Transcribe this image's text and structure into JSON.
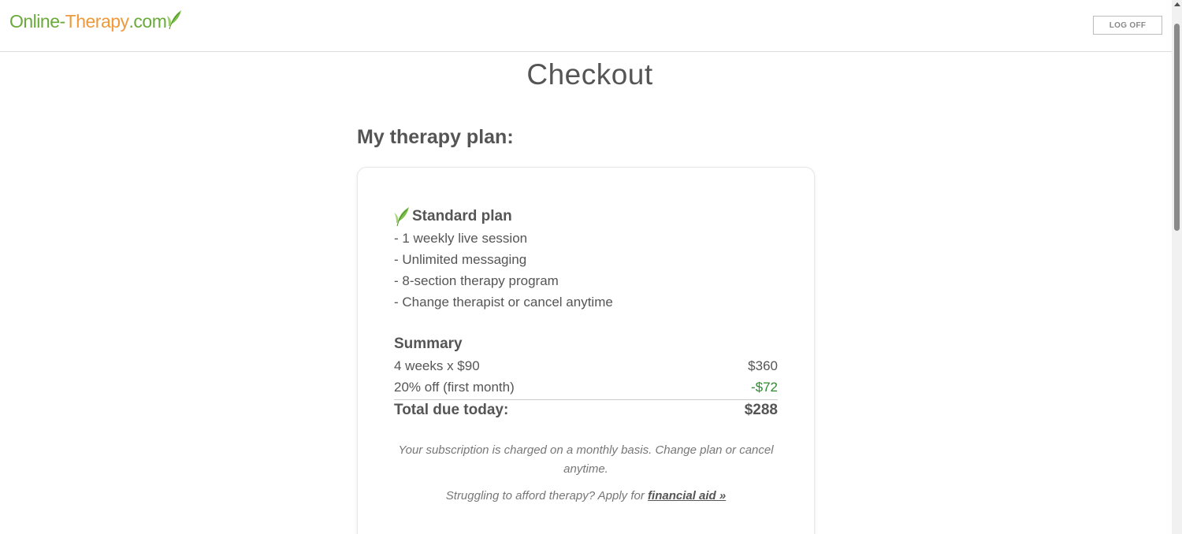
{
  "header": {
    "logo_part1": "Online-",
    "logo_part2": "Therapy",
    "logo_part3": ".com",
    "logoff_label": "LOG OFF"
  },
  "page": {
    "title": "Checkout",
    "plan_heading": "My therapy plan:"
  },
  "plan": {
    "name": "Standard plan",
    "features": [
      "- 1 weekly live session",
      "- Unlimited messaging",
      "- 8-section therapy program",
      "- Change therapist or cancel anytime"
    ]
  },
  "summary": {
    "title": "Summary",
    "lines": [
      {
        "label": "4 weeks x $90",
        "amount": "$360"
      },
      {
        "label": "20% off (first month)",
        "amount": "-$72"
      }
    ],
    "total_label": "Total due today:",
    "total_amount": "$288"
  },
  "notes": {
    "subscription": "Your subscription is charged on a monthly basis. Change plan or cancel anytime.",
    "aid_prefix": "Struggling to afford therapy? Apply for ",
    "aid_link": "financial aid »"
  },
  "colors": {
    "brand_green": "#6aaa3a",
    "brand_orange": "#ee9a3c",
    "discount_green": "#2e8b2e"
  }
}
